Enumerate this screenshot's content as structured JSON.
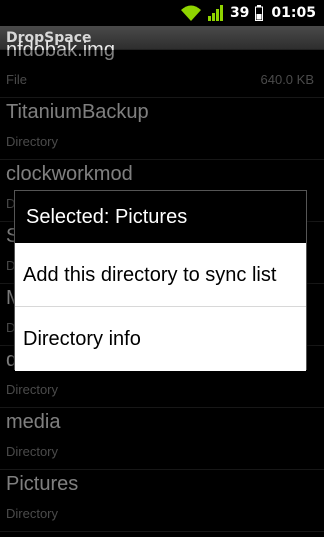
{
  "status_bar": {
    "battery_level": "39",
    "time": "01:05"
  },
  "app": {
    "title": "DropSpace"
  },
  "files": [
    {
      "name": "nfdobak.img",
      "type": "File",
      "size": "640.0 KB"
    },
    {
      "name": "TitaniumBackup",
      "type": "Directory",
      "size": ""
    },
    {
      "name": "clockworkmod",
      "type": "Directory",
      "size": ""
    },
    {
      "name": "S",
      "type": "Directory",
      "size": ""
    },
    {
      "name": "M",
      "type": "Directory",
      "size": ""
    },
    {
      "name": "d",
      "type": "Directory",
      "size": ""
    },
    {
      "name": "media",
      "type": "Directory",
      "size": ""
    },
    {
      "name": "Pictures",
      "type": "Directory",
      "size": ""
    }
  ],
  "dialog": {
    "title": "Selected: Pictures",
    "items": [
      "Add this directory to sync list",
      "Directory info"
    ]
  }
}
